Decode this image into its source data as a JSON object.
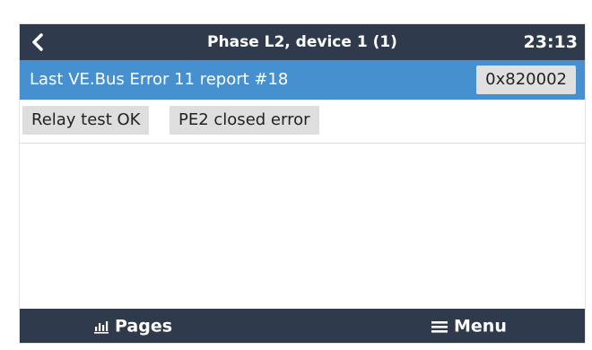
{
  "header": {
    "title": "Phase L2, device 1 (1)",
    "time": "23:13",
    "back_icon": "chevron-left-icon"
  },
  "error_report": {
    "label": "Last VE.Bus Error 11 report #18",
    "code": "0x820002"
  },
  "status_items": [
    {
      "label": "Relay test OK"
    },
    {
      "label": "PE2 closed error"
    }
  ],
  "footer": {
    "pages_label": "Pages",
    "pages_icon": "bar-chart-icon",
    "menu_label": "Menu",
    "menu_icon": "hamburger-menu-icon"
  },
  "colors": {
    "header_bg": "#2f3b4d",
    "highlight_row": "#4790d0",
    "chip_bg": "#dedede"
  }
}
